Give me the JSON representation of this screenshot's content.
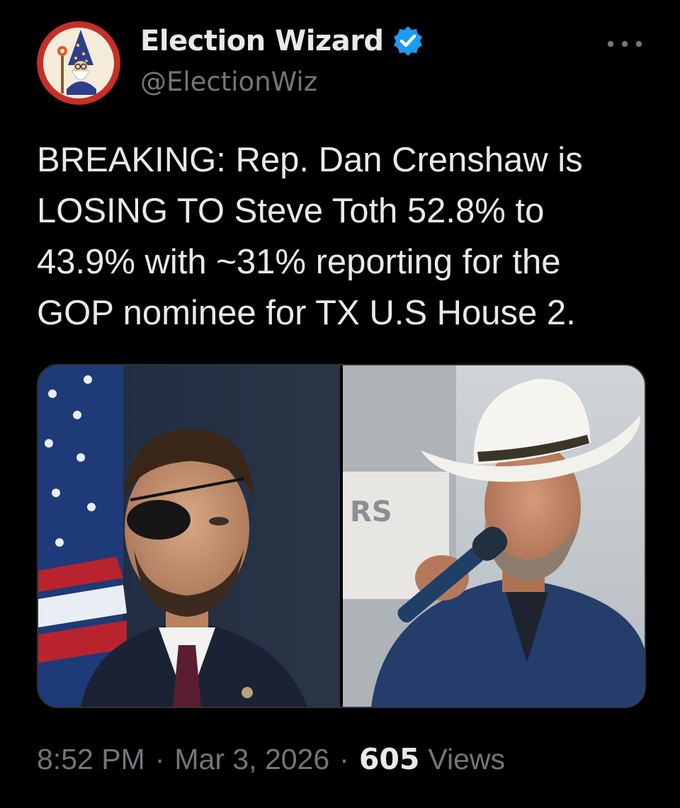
{
  "author": {
    "display_name": "Election Wizard",
    "handle": "@ElectionWiz",
    "verified": true,
    "avatar_icon": "wizard-logo-icon",
    "verified_icon": "verified-badge-icon"
  },
  "menu": {
    "icon": "more-horizontal-icon"
  },
  "tweet": {
    "text": "BREAKING: Rep. Dan Crenshaw is\nLOSING TO Steve Toth 52.8% to\n43.9% with ~31% reporting for the\nGOP nominee for TX U.S House 2."
  },
  "media": {
    "photos": [
      {
        "name": "photo-left"
      },
      {
        "name": "photo-right"
      }
    ]
  },
  "meta": {
    "time": "8:52 PM",
    "separator": "·",
    "date": "Mar 3, 2026",
    "views_count": "605",
    "views_label": "Views"
  },
  "colors": {
    "background": "#000000",
    "text_primary": "#e7e9ea",
    "text_secondary": "#71767b",
    "verified_blue": "#1d9bf0",
    "border": "#2f3336"
  }
}
